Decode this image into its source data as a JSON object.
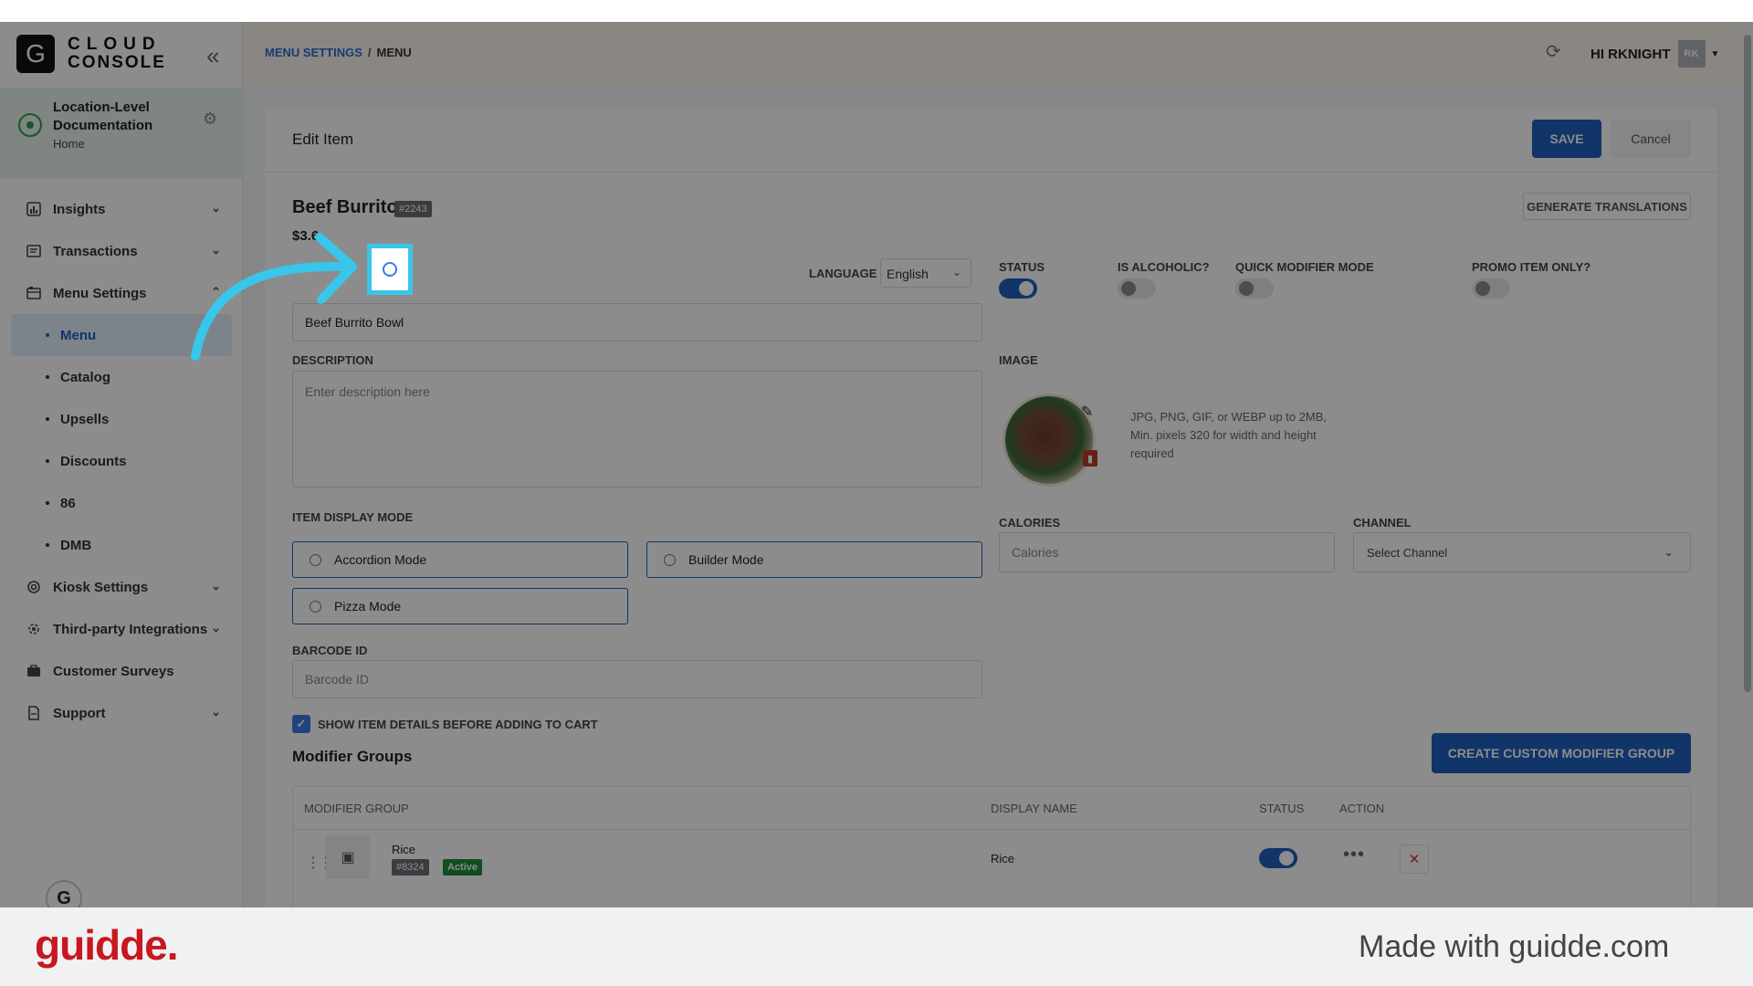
{
  "brand": {
    "letter": "G",
    "line1": "CLOUD",
    "line2": "CONSOLE"
  },
  "location": {
    "name": "Location-Level Documentation",
    "sub": "Home"
  },
  "sidebar": {
    "items": [
      {
        "label": "Insights"
      },
      {
        "label": "Transactions"
      },
      {
        "label": "Menu Settings"
      },
      {
        "label": "Kiosk Settings"
      },
      {
        "label": "Third-party Integrations"
      },
      {
        "label": "Customer Surveys"
      },
      {
        "label": "Support"
      }
    ],
    "sub_items": [
      {
        "label": "Menu"
      },
      {
        "label": "Catalog"
      },
      {
        "label": "Upsells"
      },
      {
        "label": "Discounts"
      },
      {
        "label": "86"
      },
      {
        "label": "DMB"
      }
    ]
  },
  "breadcrumb": {
    "parent": "MENU SETTINGS",
    "sep": "/",
    "current": "MENU"
  },
  "user": {
    "greeting": "HI RKNIGHT",
    "initials": "RK"
  },
  "card": {
    "title": "Edit Item",
    "save": "SAVE",
    "cancel": "Cancel"
  },
  "item": {
    "name": "Beef Burrito",
    "id": "#2243",
    "price": "$3.6"
  },
  "gen_translations": "GENERATE TRANSLATIONS",
  "language": {
    "label": "LANGUAGE",
    "value": "English"
  },
  "name_field": {
    "value": "Beef Burrito Bowl"
  },
  "description": {
    "label": "DESCRIPTION",
    "placeholder": "Enter description here"
  },
  "display_mode": {
    "label": "ITEM DISPLAY MODE",
    "options": [
      "Accordion Mode",
      "Builder Mode",
      "Pizza Mode"
    ]
  },
  "barcode": {
    "label": "BARCODE ID",
    "placeholder": "Barcode ID"
  },
  "show_details": {
    "label": "SHOW ITEM DETAILS BEFORE ADDING TO CART",
    "checked": true
  },
  "flags": [
    {
      "label": "STATUS",
      "on": true
    },
    {
      "label": "IS ALCOHOLIC?",
      "on": false
    },
    {
      "label": "QUICK MODIFIER MODE",
      "on": false
    },
    {
      "label": "PROMO ITEM ONLY?",
      "on": false
    }
  ],
  "image": {
    "label": "IMAGE",
    "hint": "JPG, PNG, GIF, or WEBP up to 2MB, Min. pixels 320 for width and height required"
  },
  "calories": {
    "label": "CALORIES",
    "placeholder": "Calories"
  },
  "channel": {
    "label": "CHANNEL",
    "placeholder": "Select Channel"
  },
  "modifier_groups": {
    "title": "Modifier Groups",
    "create_btn": "CREATE CUSTOM MODIFIER GROUP",
    "columns": [
      "MODIFIER GROUP",
      "DISPLAY NAME",
      "STATUS",
      "ACTION"
    ],
    "rows": [
      {
        "name": "Rice",
        "id": "#8324",
        "badge": "Active",
        "display": "Rice",
        "status": true
      }
    ]
  },
  "footer": {
    "logo": "guidde.",
    "made_with": "Made with guidde.com"
  },
  "colors": {
    "primary": "#1f5fbf",
    "highlight": "#38c6ea",
    "brand_red": "#c8171e",
    "active_green": "#1e8e3e"
  }
}
